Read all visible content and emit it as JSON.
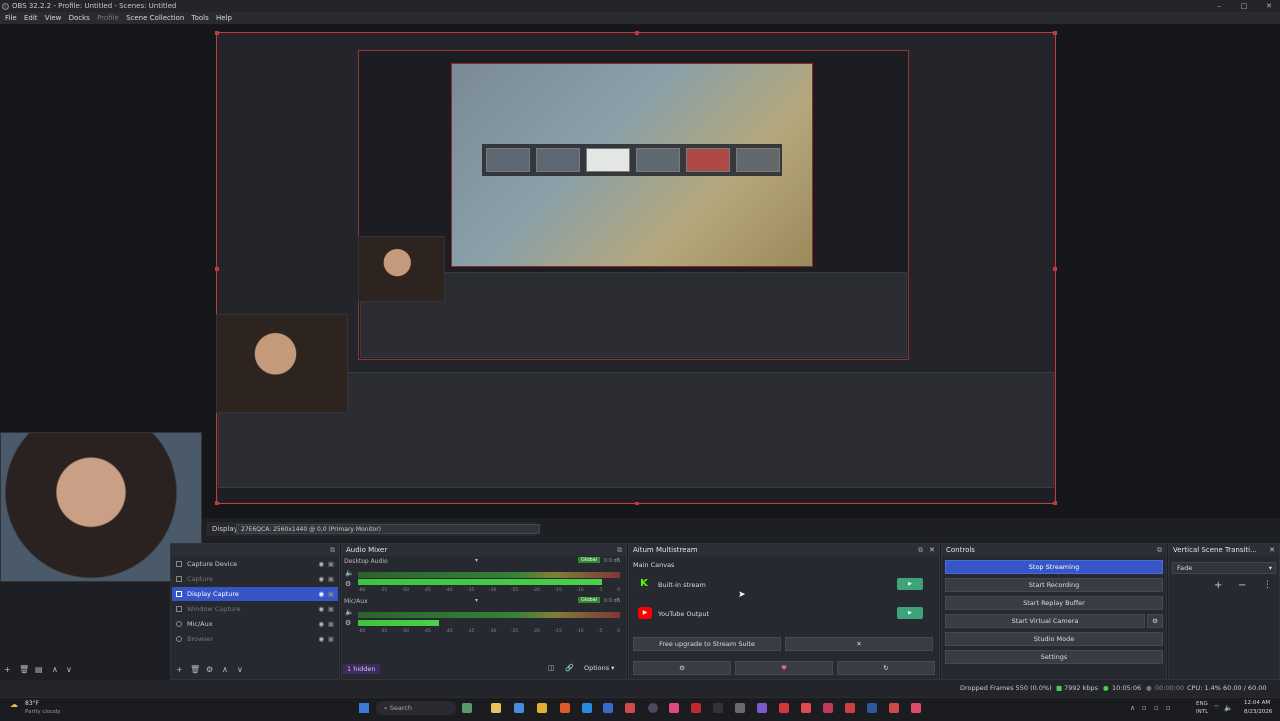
{
  "window": {
    "title": "OBS 32.2.2 - Profile: Untitled - Scenes: Untitled"
  },
  "menu": [
    "File",
    "Edit",
    "View",
    "Docks",
    "Profile",
    "Scene Collection",
    "Tools",
    "Help"
  ],
  "display": {
    "label": "Display",
    "value": "27E6QCA: 2560x1440 @ 0,0 (Primary Monitor)"
  },
  "sources": {
    "items": [
      {
        "label": "Capture Device"
      },
      {
        "label": "Capture"
      },
      {
        "label": "Display Capture"
      },
      {
        "label": "Window Capture"
      },
      {
        "label": "Mic/Aux"
      },
      {
        "label": "Browser"
      }
    ]
  },
  "audio_mixer": {
    "title": "Audio Mixer",
    "channels": [
      {
        "name": "Desktop Audio",
        "badge": "Global",
        "db": "0.0 dB",
        "level": 0.93
      },
      {
        "name": "Mic/Aux",
        "badge": "Global",
        "db": "0.0 dB",
        "level": 0.31
      }
    ],
    "scale": [
      "-60",
      "-55",
      "-50",
      "-45",
      "-40",
      "-35",
      "-30",
      "-25",
      "-20",
      "-15",
      "-10",
      "-5",
      "0"
    ],
    "hidden": "1 hidden",
    "options": "Options"
  },
  "multistream": {
    "title": "Aitum Multistream",
    "canvas": "Main Canvas",
    "outputs": [
      {
        "label": "Built-in stream"
      },
      {
        "label": "YouTube Output"
      }
    ],
    "upgrade": "Free upgrade to Stream Suite"
  },
  "controls": {
    "title": "Controls",
    "buttons": [
      "Stop Streaming",
      "Start Recording",
      "Start Replay Buffer",
      "Start Virtual Camera",
      "Studio Mode",
      "Settings"
    ]
  },
  "vertical": {
    "title": "Vertical Scene Transiti...",
    "transition": "Fade"
  },
  "status": {
    "dropped": "Dropped Frames 550 (0.0%)",
    "kbps": "7992 kbps",
    "stream_time": "10:05:06",
    "rec_time": "00:00:00",
    "cpu": "CPU: 1.4%",
    "fps": "60.00 / 60.00 FPS"
  },
  "taskbar": {
    "weather_temp": "83°F",
    "weather_text": "Partly cloudy",
    "search": "Search",
    "lang1": "ENG",
    "lang2": "INTL",
    "time": "12:04 AM",
    "date": "8/23/2026"
  },
  "colors": {
    "accent": "#3656c7",
    "selection_border": "#c23a3a",
    "live": "#3fa37a"
  }
}
